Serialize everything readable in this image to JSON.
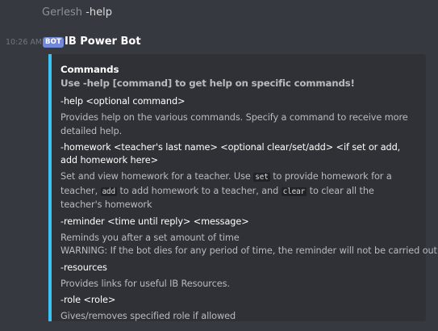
{
  "previous_message": {
    "author": "Gerlesh",
    "content": "-help"
  },
  "message": {
    "timestamp": "10:26 AM",
    "badge": "BOT",
    "author": "IB Power Bot"
  },
  "embed": {
    "accent_color": "#39c4f4",
    "title": "Commands",
    "description": "Use -help [command] to get help on specific commands!",
    "fields": [
      {
        "name": "-help <optional command>",
        "value": "Provides help on the various commands. Specify a command to receive more detailed help."
      },
      {
        "name": "-homework <teacher's last name> <optional clear/set/add> <if set or add, add homework here>",
        "value_parts": {
          "t1": "Set and view homework for a teacher. Use ",
          "c1": "set",
          "t2": " to provide homework for a teacher, ",
          "c2": "add",
          "t3": " to add homework to a teacher, and ",
          "c3": "clear",
          "t4": " to clear all the teacher's homework"
        }
      },
      {
        "name": "-reminder <time until reply> <message>",
        "value": "Reminds you after a set amount of time",
        "value_line2": "WARNING: If the bot dies for any period of time, the reminder will not be carried out."
      },
      {
        "name": "-resources",
        "value": "Provides links for useful IB Resources."
      },
      {
        "name": "-role <role>",
        "value": "Gives/removes specified role if allowed"
      }
    ]
  }
}
